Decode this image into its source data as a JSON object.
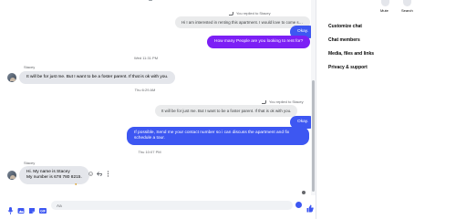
{
  "header": {
    "mute_label": "Mute",
    "search_label": "Search"
  },
  "side_panel": {
    "items": [
      {
        "label": "Customize chat"
      },
      {
        "label": "Chat members"
      },
      {
        "label": "Media, files and links"
      },
      {
        "label": "Privacy & support"
      }
    ]
  },
  "conversation": {
    "reply1": {
      "tag": "You replied to Stacey",
      "quote": "Hi I am interested in renting this apartment. I would love to come see ...",
      "bubbles": [
        "Okay.",
        "How many People are you looking to rent for?"
      ]
    },
    "timestamp1": "Wed 11:31 PM",
    "stacey1": {
      "sender": "Stacey",
      "text": "It will be for just me.  But I want to be a foster parent.  If that is ok with you."
    },
    "timestamp2": "Thu 6:29 AM",
    "reply2": {
      "tag": "You replied to Stacey",
      "quote": "It will be for just me.  But I want to be a foster parent.  If that is ok with you.",
      "bubble1": "Okay.",
      "bubble2_line1": "If possible, Send me your contact number so i can discuss the apartment and fix",
      "bubble2_line2": "schedule a tour."
    },
    "timestamp3": "Thu 10:07 PM",
    "stacey2": {
      "sender": "Stacey",
      "line1": "Hi.  My name is Stacey",
      "line2": "My number is 678 780 8215."
    }
  },
  "composer": {
    "placeholder": "Aa"
  },
  "colors": {
    "outgoing": "#3d57f2",
    "outgoing_highlight": "#7c1ff5",
    "incoming": "#e4e6eb"
  },
  "icons": [
    "mic-icon",
    "image-icon",
    "sticker-icon",
    "gif-icon",
    "emoji-icon",
    "like-icon",
    "smile-reaction-icon",
    "reply-icon",
    "more-icon",
    "bell-icon",
    "search-icon"
  ]
}
